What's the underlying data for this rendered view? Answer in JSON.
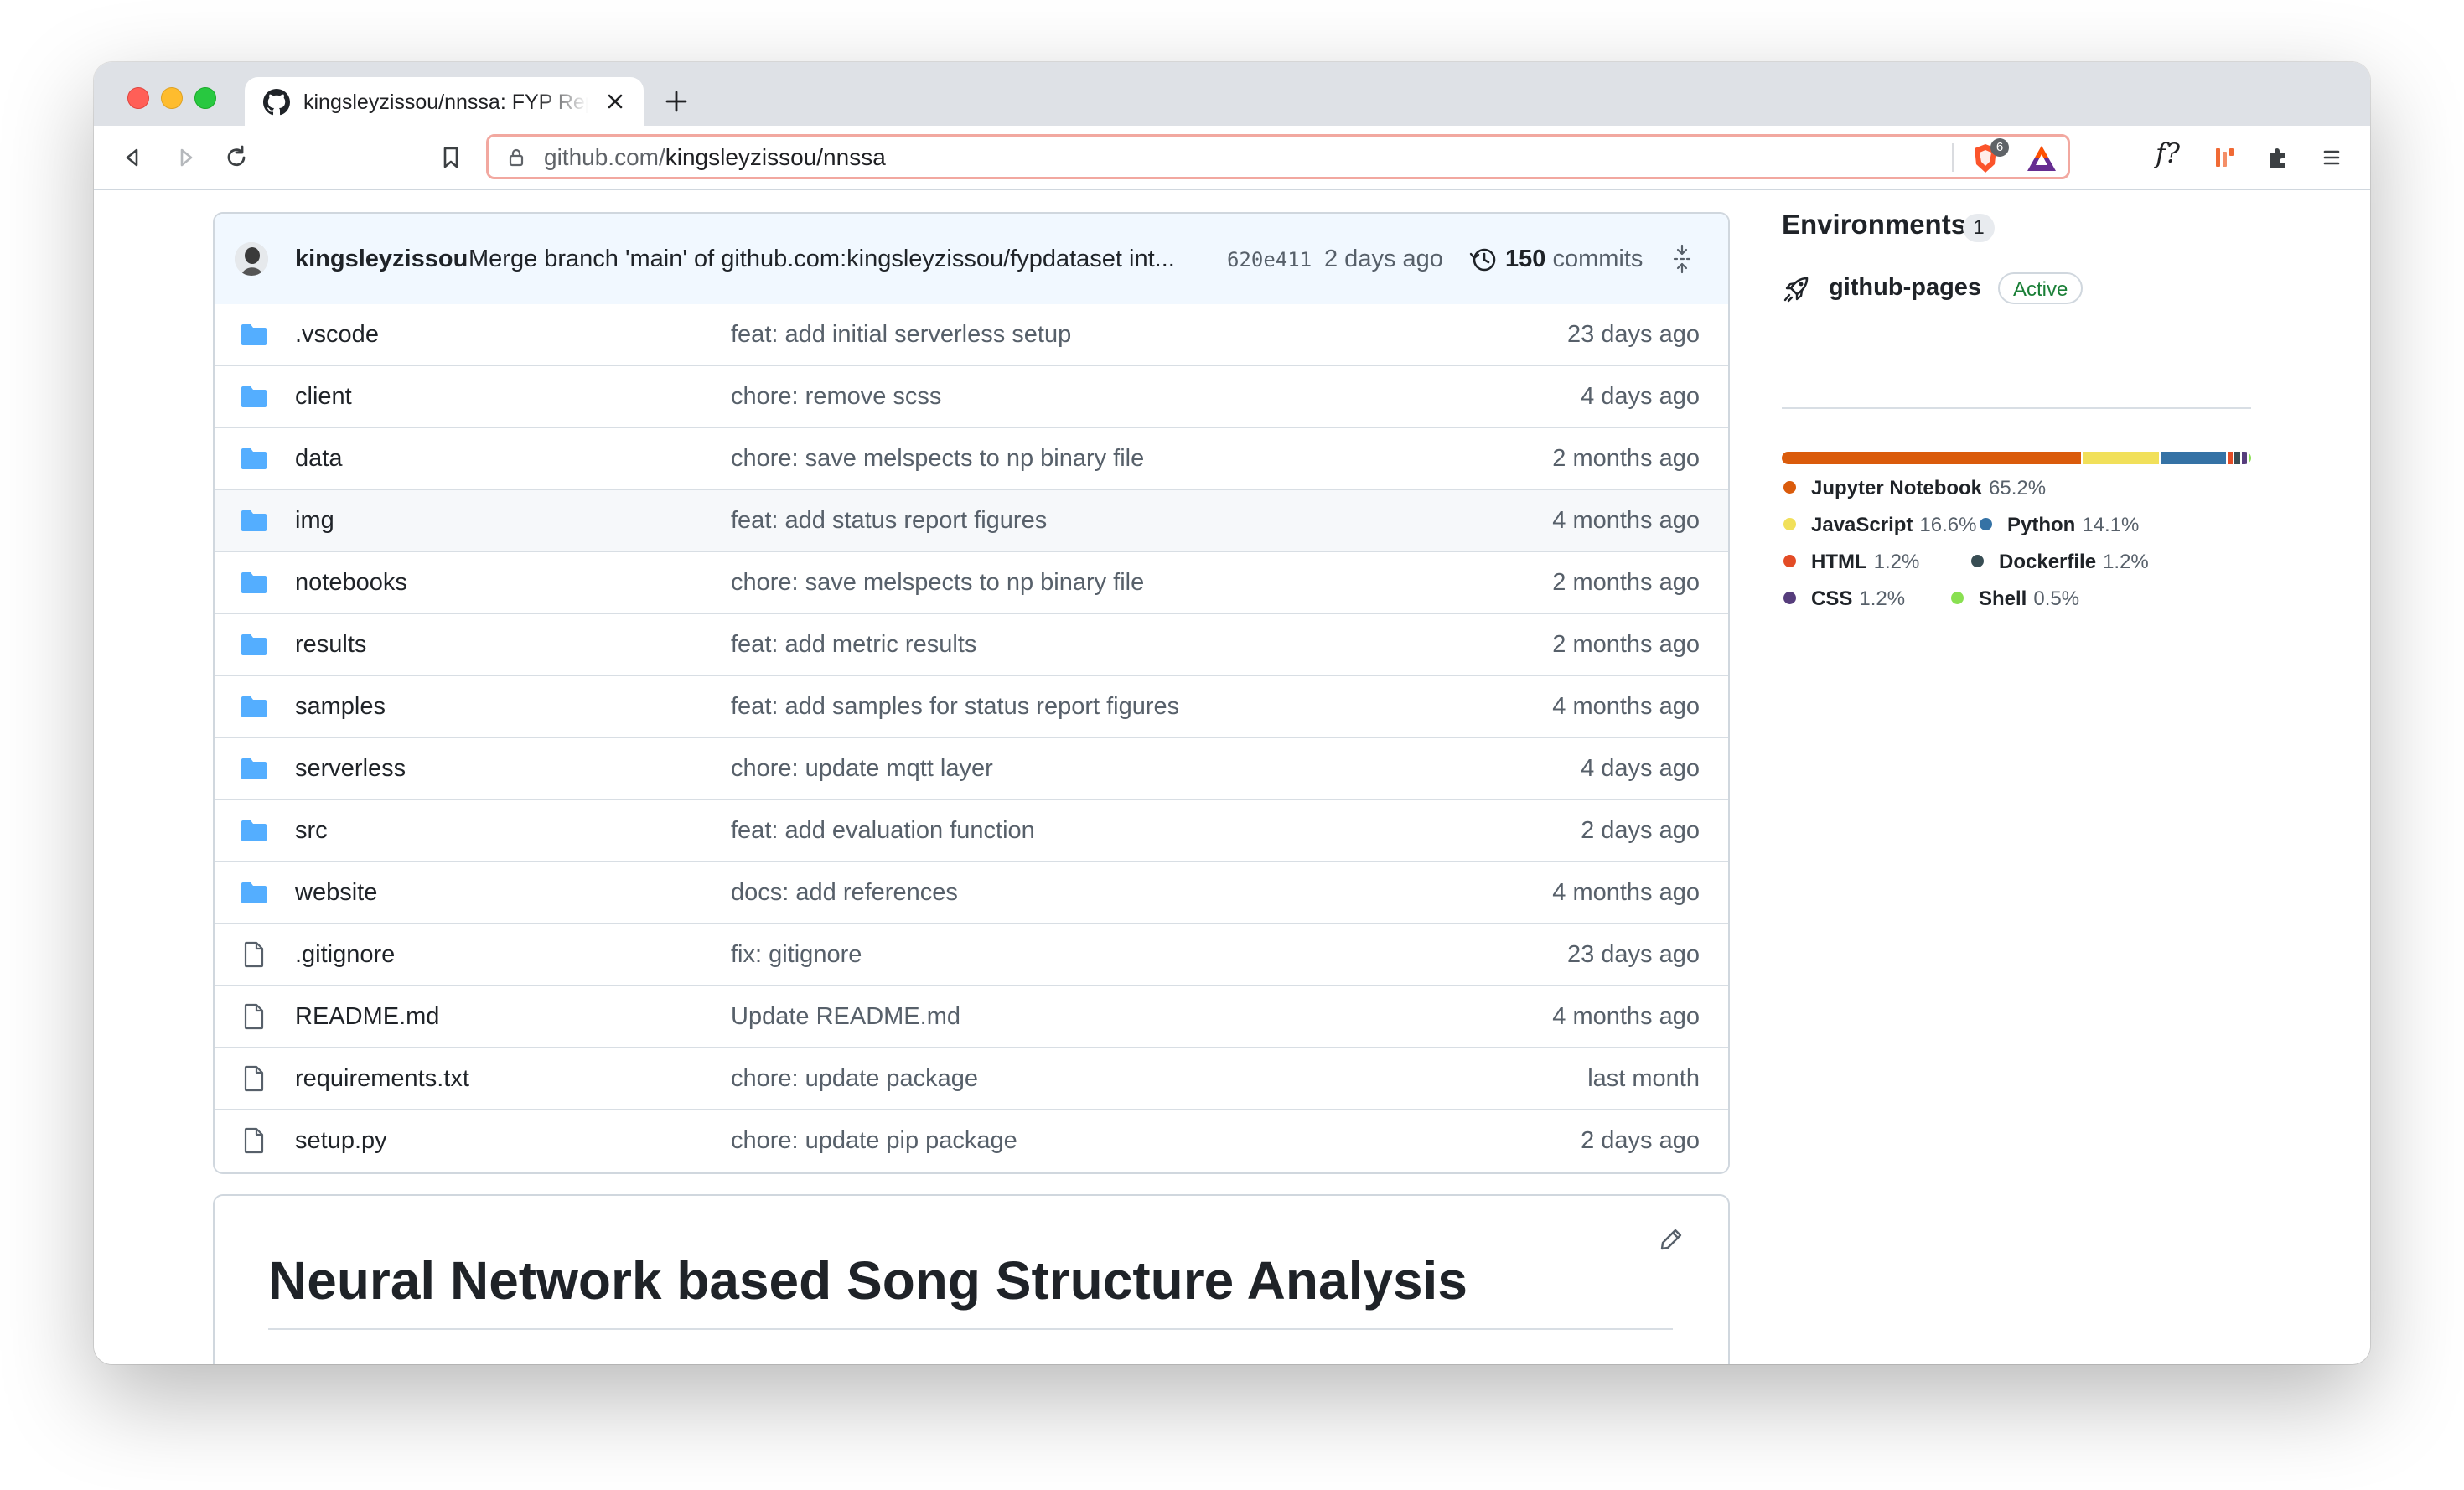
{
  "browser": {
    "tab_title": "kingsleyzissou/nnssa: FYP Repository",
    "url_prefix": "github.com/",
    "url_path": "kingsleyzissou/nnssa",
    "shield_count": "6",
    "extension_ff": "f?"
  },
  "commit": {
    "author": "kingsleyzissou",
    "message": "Merge branch 'main' of github.com:kingsleyzissou/fypdataset int...",
    "sha": "620e411",
    "date": "2 days ago",
    "count": "150",
    "count_label": "commits"
  },
  "files": [
    {
      "type": "dir",
      "name": ".vscode",
      "message": "feat: add initial serverless setup",
      "age": "23 days ago"
    },
    {
      "type": "dir",
      "name": "client",
      "message": "chore: remove scss",
      "age": "4 days ago"
    },
    {
      "type": "dir",
      "name": "data",
      "message": "chore: save melspects to np binary file",
      "age": "2 months ago"
    },
    {
      "type": "dir",
      "name": "img",
      "message": "feat: add status report figures",
      "age": "4 months ago"
    },
    {
      "type": "dir",
      "name": "notebooks",
      "message": "chore: save melspects to np binary file",
      "age": "2 months ago"
    },
    {
      "type": "dir",
      "name": "results",
      "message": "feat: add metric results",
      "age": "2 months ago"
    },
    {
      "type": "dir",
      "name": "samples",
      "message": "feat: add samples for status report figures",
      "age": "4 months ago"
    },
    {
      "type": "dir",
      "name": "serverless",
      "message": "chore: update mqtt layer",
      "age": "4 days ago"
    },
    {
      "type": "dir",
      "name": "src",
      "message": "feat: add evaluation function",
      "age": "2 days ago"
    },
    {
      "type": "dir",
      "name": "website",
      "message": "docs: add references",
      "age": "4 months ago"
    },
    {
      "type": "file",
      "name": ".gitignore",
      "message": "fix: gitignore",
      "age": "23 days ago"
    },
    {
      "type": "file",
      "name": "README.md",
      "message": "Update README.md",
      "age": "4 months ago"
    },
    {
      "type": "file",
      "name": "requirements.txt",
      "message": "chore: update package",
      "age": "last month"
    },
    {
      "type": "file",
      "name": "setup.py",
      "message": "chore: update pip package",
      "age": "2 days ago"
    }
  ],
  "readme": {
    "title": "Neural Network based Song Structure Analysis"
  },
  "environments": {
    "title": "Environments",
    "count": "1",
    "items": [
      {
        "name": "github-pages",
        "status": "Active"
      }
    ]
  },
  "languages": [
    {
      "name": "Jupyter Notebook",
      "percent": "65.2%",
      "value": 65.2,
      "color": "#DA5B0B"
    },
    {
      "name": "JavaScript",
      "percent": "16.6%",
      "value": 16.6,
      "color": "#f1e05a"
    },
    {
      "name": "Python",
      "percent": "14.1%",
      "value": 14.1,
      "color": "#3572A5"
    },
    {
      "name": "HTML",
      "percent": "1.2%",
      "value": 1.2,
      "color": "#e34c26"
    },
    {
      "name": "Dockerfile",
      "percent": "1.2%",
      "value": 1.2,
      "color": "#384d54"
    },
    {
      "name": "CSS",
      "percent": "1.2%",
      "value": 1.2,
      "color": "#563d7c"
    },
    {
      "name": "Shell",
      "percent": "0.5%",
      "value": 0.5,
      "color": "#89e051"
    }
  ]
}
